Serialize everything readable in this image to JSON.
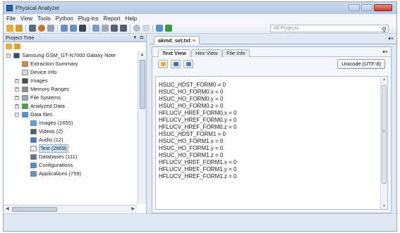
{
  "window": {
    "title": "Physical Analyzer"
  },
  "menu": [
    "File",
    "View",
    "Tools",
    "Python",
    "Plug-ins",
    "Report",
    "Help"
  ],
  "toolbar": {
    "search_placeholder": "All Projects"
  },
  "project_tree": {
    "title": "Project Tree",
    "items": [
      {
        "label": "Samsung GSM_GT-N7000 Galaxy Note",
        "level": 0,
        "expander": "−",
        "icon": "phone-icon",
        "color": "#3a4b5e"
      },
      {
        "label": "Extraction Summary",
        "level": 1,
        "expander": "",
        "icon": "summary-icon",
        "color": "#d98d2b"
      },
      {
        "label": "Device Info",
        "level": 1,
        "expander": "",
        "icon": "document-icon",
        "color": "#d8dde4"
      },
      {
        "label": "Images",
        "level": 1,
        "expander": "+",
        "icon": "images-icon",
        "color": "#4a4a4a"
      },
      {
        "label": "Memory Ranges",
        "level": 1,
        "expander": "+",
        "icon": "memory-icon",
        "color": "#8a8f96"
      },
      {
        "label": "File Systems",
        "level": 1,
        "expander": "+",
        "icon": "filesystem-icon",
        "color": "#9ea7b3"
      },
      {
        "label": "Analyzed Data",
        "level": 1,
        "expander": "+",
        "icon": "analyzed-data-icon",
        "color": "#49a23a"
      },
      {
        "label": "Data files",
        "level": 1,
        "expander": "−",
        "icon": "data-files-icon",
        "color": "#4c93d1"
      },
      {
        "label": "Images (1655)",
        "level": 2,
        "expander": "",
        "icon": "image-file-icon",
        "color": "#5aa0dc"
      },
      {
        "label": "Videos (2)",
        "level": 2,
        "expander": "",
        "icon": "video-icon",
        "color": "#555b63"
      },
      {
        "label": "Audio (12)",
        "level": 2,
        "expander": "",
        "icon": "audio-icon",
        "color": "#3f79c9"
      },
      {
        "label": "Text (2669)",
        "level": 2,
        "expander": "",
        "icon": "text-file-icon",
        "color": "#e9edf2",
        "selected": true
      },
      {
        "label": "Databases (111)",
        "level": 2,
        "expander": "",
        "icon": "database-icon",
        "color": "#6a7480"
      },
      {
        "label": "Configurations",
        "level": 2,
        "expander": "",
        "icon": "configuration-icon",
        "color": "#4e8ed2"
      },
      {
        "label": "Applications (759)",
        "level": 2,
        "expander": "",
        "icon": "applications-icon",
        "color": "#6a93c4"
      }
    ]
  },
  "document_tab": {
    "label": "akmd_set.txt",
    "close": "×"
  },
  "view_tabs": [
    "Text View",
    "Hex View",
    "File Info"
  ],
  "encoding_button": "Unicode (UTF-8)",
  "text_lines": [
    "HSUC_HDST_FORM0 = 0",
    "HSUC_HO_FORM0.x = 0",
    "HSUC_HO_FORM0.y = 0",
    "HSUC_HO_FORM0.z = 0",
    "HFLUCV_HREF_FORM0.x = 0",
    "HFLUCV_HREF_FORM0.y = 0",
    "HFLUCV_HREF_FORM0.z = 0",
    "HSUC_HDST_FORM1 = 0",
    "HSUC_HO_FORM1.x = 0",
    "HSUC_HO_FORM1.y = 0",
    "HSUC_HO_FORM1.z = 0",
    "HFLUCV_HREF_FORM1.x = 0",
    "HFLUCV_HREF_FORM1.y = 0",
    "HFLUCV_HREF_FORM1.z = 0"
  ]
}
